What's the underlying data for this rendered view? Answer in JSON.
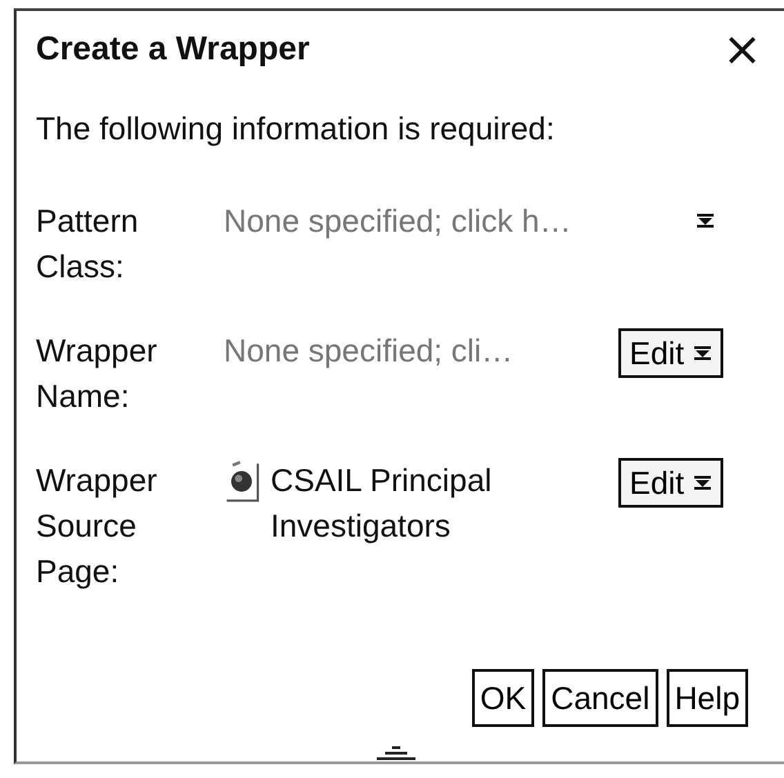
{
  "window": {
    "title": "Create a Wrapper",
    "close": "×"
  },
  "prompt": "The following information is required:",
  "fields": [
    {
      "label": "Pattern Class:",
      "kind": "placeholder",
      "placeholder": "None specified; click h…"
    },
    {
      "label": "Wrapper Name:",
      "kind": "placeholder",
      "placeholder": "None specified; cli…",
      "button": "Edit"
    },
    {
      "label": "Wrapper Source Page:",
      "kind": "page",
      "value": "CSAIL Principal Investigators",
      "button": "Edit"
    }
  ],
  "buttons": [
    "OK",
    "Cancel",
    "Help"
  ]
}
